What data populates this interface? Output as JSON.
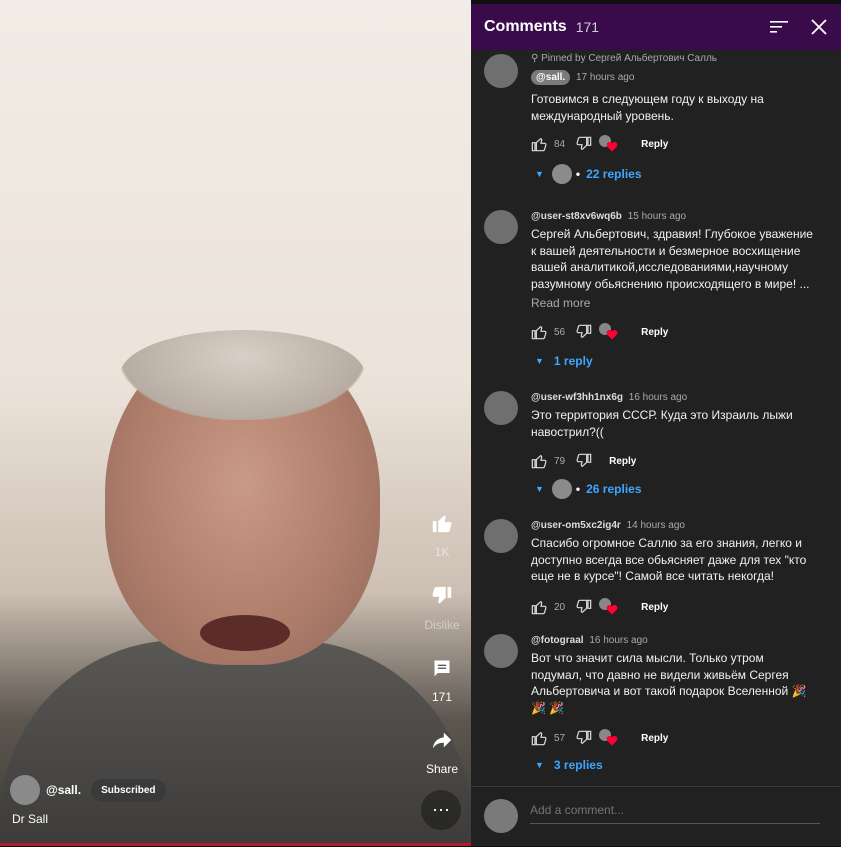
{
  "video": {
    "channel_handle": "@sall.",
    "subscribe_label": "Subscribed",
    "title": "Dr Sall",
    "like_count": "1K",
    "dislike_label": "Dislike",
    "comment_count": "171",
    "share_label": "Share",
    "more_label": "⋯"
  },
  "panel": {
    "title": "Comments",
    "count": "171",
    "sort_icon": "sort-icon",
    "close_icon": "close-icon"
  },
  "comments": [
    {
      "pinned": "Pinned by Сергей Альбертович Салль",
      "author": "@sall.",
      "time": "17 hours ago",
      "text": "Готовимся в следующем году к выходу на\nмеждународный уровень.",
      "likes": "84",
      "reply_label": "Reply",
      "replies": "22 replies"
    },
    {
      "author": "@user-st8xv6wq6b",
      "time": "15 hours ago",
      "text": "Сергей Альбертович, здравия! Глубокое уважение\nк вашей деятельности и безмерное восхищение\nвашей аналитикой,исследованиями,научному\nразумному обьяснению  происходящего в мире! ...",
      "read_more": "Read more",
      "likes": "56",
      "reply_label": "Reply",
      "replies": "1 reply"
    },
    {
      "author": "@user-wf3hh1nx6g",
      "time": "16 hours ago",
      "text": "Это территория СССР.  Куда это Израиль лыжи\nнавострил?((",
      "likes": "79",
      "reply_label": "Reply",
      "replies": "26 replies"
    },
    {
      "author": "@user-om5xc2ig4r",
      "time": "14 hours ago",
      "text": "Спасибо огромное Саллю за его знания, легко и\nдоступно всегда все обьясняет даже для тех \"кто\nеще не в курсе\"! Самой все читать некогда!",
      "likes": "20",
      "reply_label": "Reply"
    },
    {
      "author": "@fotograal",
      "time": "16 hours ago",
      "text": "Вот что значит сила мысли. Только утром\nподумал, что давно не видели живьём Сергея\nАльбертовича и вот такой подарок Вселенной 🎉\n🎉 🎉",
      "likes": "57",
      "reply_label": "Reply",
      "replies": "3 replies"
    }
  ],
  "add_comment": {
    "placeholder": "Add a comment..."
  },
  "colors": {
    "header_bg": "#3a0b4a",
    "panel_bg": "#212121",
    "link_blue": "#3ea6ff",
    "heart_red": "#ff0033"
  }
}
